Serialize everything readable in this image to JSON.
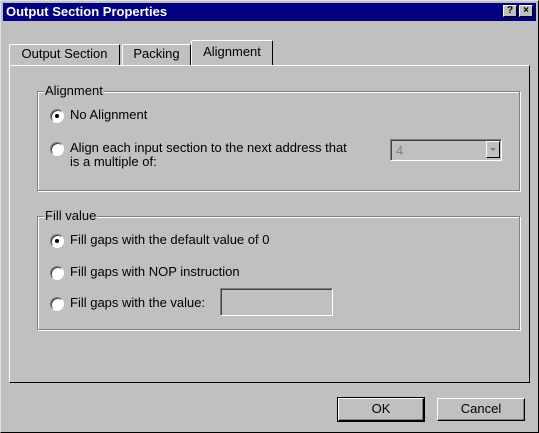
{
  "window": {
    "title": "Output Section Properties",
    "help_glyph": "?",
    "close_glyph": "×"
  },
  "tabs": [
    {
      "label": "Output Section",
      "active": false
    },
    {
      "label": "Packing",
      "active": false
    },
    {
      "label": "Alignment",
      "active": true
    }
  ],
  "alignment_group": {
    "legend": "Alignment",
    "options": [
      {
        "label": "No Alignment",
        "selected": true
      },
      {
        "label_line1": "Align each input section to the next address that",
        "label_line2": "is a multiple of:",
        "selected": false
      }
    ],
    "multiple_value": "4"
  },
  "fill_group": {
    "legend": "Fill value",
    "options": [
      {
        "label": "Fill gaps with the default value of 0",
        "selected": true
      },
      {
        "label": "Fill gaps with NOP instruction",
        "selected": false
      },
      {
        "label": "Fill gaps with the value:",
        "selected": false
      }
    ],
    "fill_value": ""
  },
  "buttons": {
    "ok": "OK",
    "cancel": "Cancel"
  },
  "colors": {
    "titlebar": "#000080",
    "face": "#c0c0c0",
    "disabled_text": "#808080"
  }
}
